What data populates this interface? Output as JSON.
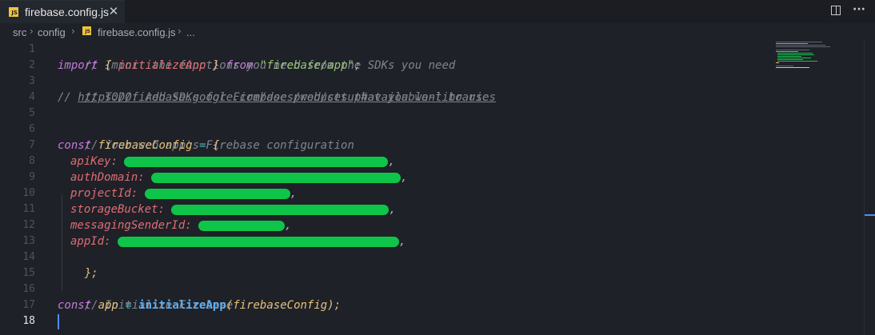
{
  "tab": {
    "badge": "JS",
    "filename": "firebase.config.js",
    "close": "✕"
  },
  "breadcrumb": {
    "items": [
      "src",
      "config",
      "firebase.config.js",
      "..."
    ],
    "badge": "JS"
  },
  "editor": {
    "line_numbers": [
      "1",
      "2",
      "3",
      "4",
      "5",
      "6",
      "7",
      "8",
      "9",
      "10",
      "11",
      "12",
      "13",
      "14",
      "15",
      "16",
      "17",
      "18"
    ],
    "active_line": "18",
    "lines": {
      "l1": "// Import the functions you need from the SDKs you need",
      "l2_import": "import",
      "l2_open": "{",
      "l2_name": "initializeApp",
      "l2_close": "}",
      "l2_from": "from",
      "l2_str": "\"firebase/app\"",
      "l2_semi": ";",
      "l3": "// TODO: Add SDKs for Firebase products that you want to use",
      "l4_prefix": "// ",
      "l4_link": "https://firebase.google.com/docs/web/setup#available-libraries",
      "l6": "// Your web app's Firebase configuration",
      "l7_const": "const",
      "l7_name": "firebaseConfig",
      "l7_eq": "=",
      "l7_brace": "{",
      "l8_key": "apiKey:",
      "l9_key": "authDomain:",
      "l10_key": "projectId:",
      "l11_key": "storageBucket:",
      "l12_key": "messagingSenderId:",
      "l13_key": "appId:",
      "comma": ",",
      "l14": "};",
      "l16": "// Initialize Firebase",
      "l17_const": "const",
      "l17_name": "app",
      "l17_eq": "=",
      "l17_call": "initializeApp",
      "l17_open": "(",
      "l17_arg": "firebaseConfig",
      "l17_close": ");"
    }
  },
  "colors": {
    "background": "#1e2127",
    "comment": "#7f848e",
    "keyword": "#c678dd",
    "string": "#98c379",
    "function": "#61afef",
    "property": "#e06c75",
    "redaction": "#0ec54a"
  },
  "icons": [
    "js-file-icon",
    "close-icon",
    "split-editor-icon",
    "more-actions-icon"
  ]
}
